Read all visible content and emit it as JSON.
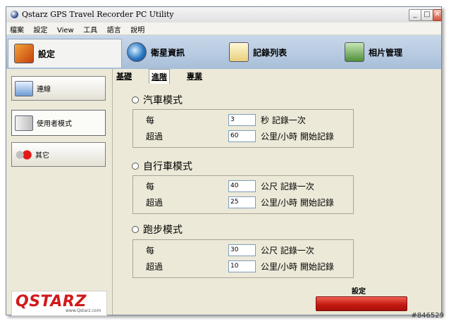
{
  "window": {
    "title": "Qstarz GPS Travel Recorder PC Utility"
  },
  "titlebar_buttons": {
    "minimize": "_",
    "maximize": "□",
    "close": "✕"
  },
  "menu": [
    "檔案",
    "設定",
    "View",
    "工具",
    "語言",
    "說明"
  ],
  "toolbar": [
    {
      "label": "設定",
      "icon": "settings-tool-icon",
      "active": true
    },
    {
      "label": "衛星資訊",
      "icon": "satellite-globe-icon",
      "active": false
    },
    {
      "label": "記錄列表",
      "icon": "log-list-icon",
      "active": false
    },
    {
      "label": "相片管理",
      "icon": "photo-manager-icon",
      "active": false
    }
  ],
  "sidebar": [
    {
      "label": "連線",
      "icon": "connection-pc-icon",
      "active": false
    },
    {
      "label": "使用者模式",
      "icon": "user-mode-icon",
      "active": true
    },
    {
      "label": "其它",
      "icon": "other-traffic-light-icon",
      "active": false
    }
  ],
  "logo": {
    "brand": "QSTARZ",
    "url": "www.Qstarz.com"
  },
  "tabs": [
    {
      "label": "基礎",
      "active": false
    },
    {
      "label": "進階",
      "active": true
    },
    {
      "label": "專業",
      "active": false
    }
  ],
  "modes": {
    "car": {
      "title": "汽車模式",
      "row1": {
        "label": "每",
        "value": "3",
        "unit": "秒 記錄一次"
      },
      "row2": {
        "label": "超過",
        "value": "60",
        "unit": "公里/小時 開始記錄"
      }
    },
    "bike": {
      "title": "自行車模式",
      "row1": {
        "label": "每",
        "value": "40",
        "unit": "公尺 記錄一次"
      },
      "row2": {
        "label": "超過",
        "value": "25",
        "unit": "公里/小時 開始記錄"
      }
    },
    "run": {
      "title": "跑步模式",
      "row1": {
        "label": "每",
        "value": "30",
        "unit": "公尺 記錄一次"
      },
      "row2": {
        "label": "超過",
        "value": "10",
        "unit": "公里/小時 開始記錄"
      }
    }
  },
  "save": {
    "label": "設定"
  },
  "watermark": "#846529",
  "colors": {
    "toolbar_bg": "#b8cce3",
    "save_button": "#c51a12",
    "logo_red": "#d11a1a"
  }
}
